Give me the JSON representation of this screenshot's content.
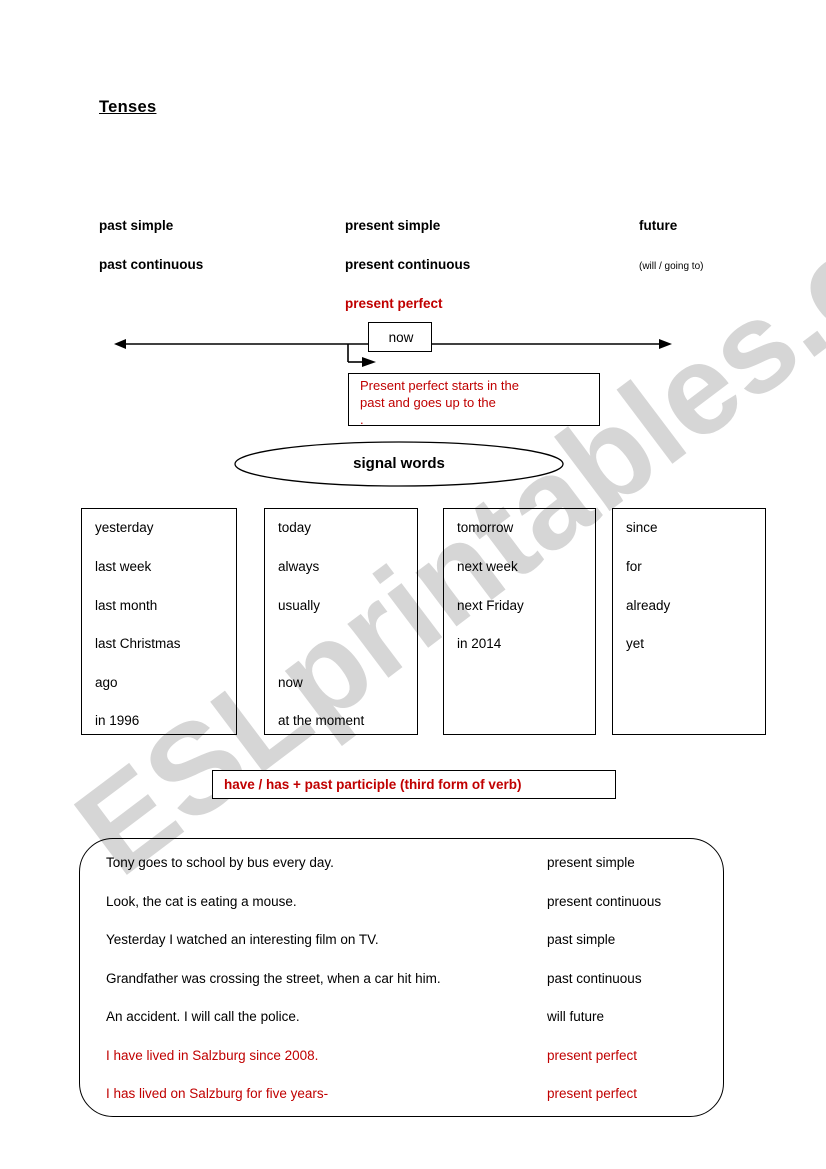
{
  "page": {
    "title": "Tenses",
    "watermark": "ESLprintables.com",
    "accent_red": "#c00000"
  },
  "tense_columns": [
    {
      "name": "past",
      "line1": "past simple",
      "line2": "past continuous",
      "line3": ""
    },
    {
      "name": "present",
      "line1": "present simple",
      "line2": "present continuous",
      "line3": "present perfect"
    },
    {
      "name": "future",
      "line1": "future",
      "line2": "(will / going to)",
      "line3": ""
    }
  ],
  "timeline": {
    "now_label": "now",
    "note": {
      "line1": "Present perfect starts in the",
      "line2": "past and goes up to the",
      "line3": "."
    }
  },
  "signal_words": {
    "heading": "signal words",
    "groups": [
      {
        "name": "past-signal-words",
        "items": [
          "yesterday",
          "last week",
          "last month",
          "last Christmas",
          "ago",
          "in 1996"
        ]
      },
      {
        "name": "present-signal-words",
        "items": [
          "today",
          "always",
          "usually",
          "",
          "now",
          "at the moment"
        ]
      },
      {
        "name": "future-signal-words",
        "items": [
          "tomorrow",
          "next week",
          "next Friday",
          "in 2014",
          "",
          ""
        ]
      },
      {
        "name": "present-perfect-signal-words",
        "items": [
          "since",
          "for",
          "already",
          "yet",
          "",
          ""
        ]
      }
    ]
  },
  "formula": {
    "text": "have / has + past participle (third form of verb)"
  },
  "examples": [
    {
      "sentence": "Tony goes to school by bus every day.",
      "answer": "present simple",
      "red": false
    },
    {
      "sentence": "Look, the cat is eating a mouse.",
      "answer": "present continuous",
      "red": false
    },
    {
      "sentence": "Yesterday I watched an interesting film on TV.",
      "answer": "past simple",
      "red": false
    },
    {
      "sentence": "Grandfather was crossing the street, when a car hit him.",
      "answer": "past continuous",
      "red": false
    },
    {
      "sentence": "An accident. I will call the police.",
      "answer": "will future",
      "red": false
    },
    {
      "sentence": "I have lived in Salzburg since 2008.",
      "answer": "present perfect",
      "red": true
    },
    {
      "sentence": "I has lived on Salzburg for five years-",
      "answer": "present perfect",
      "red": true
    }
  ]
}
